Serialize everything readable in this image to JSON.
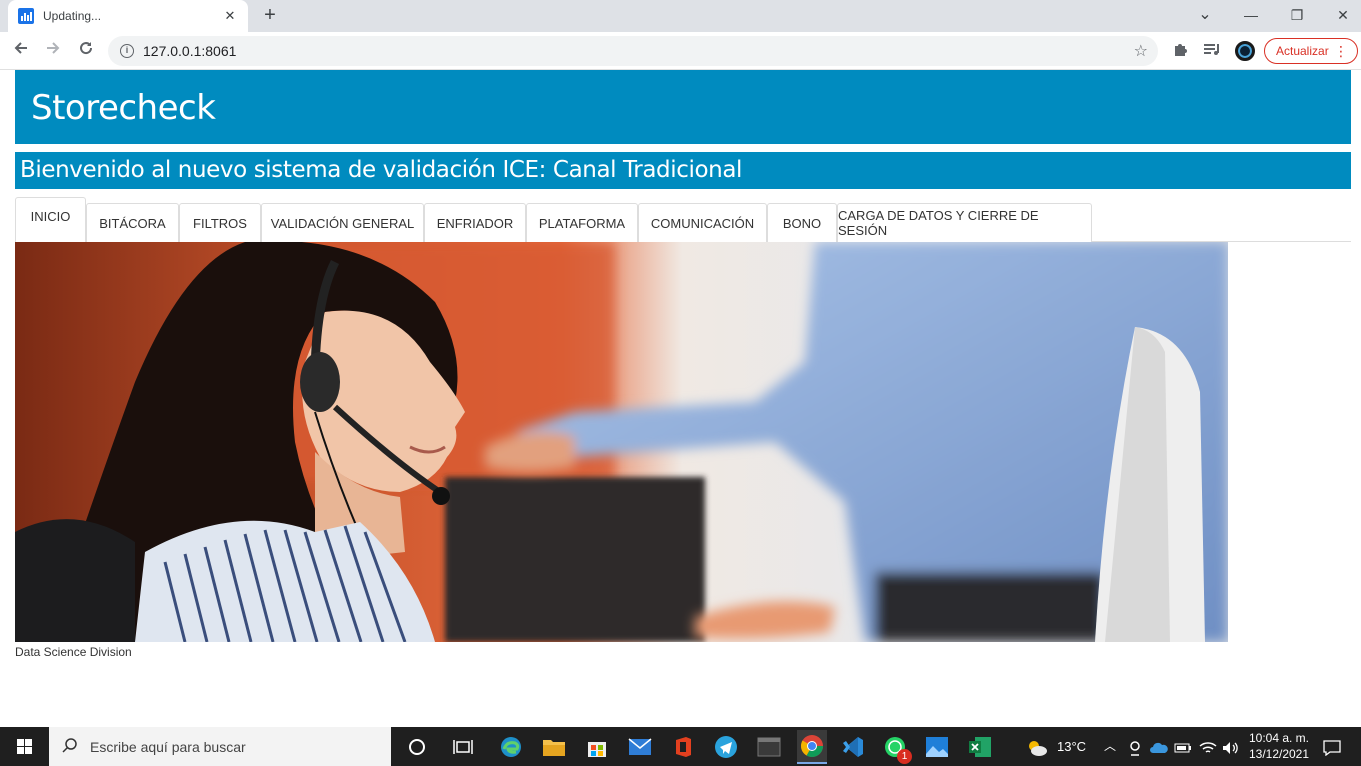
{
  "browser": {
    "tab_title": "Updating...",
    "tab_close": "✕",
    "new_tab": "+",
    "url": "127.0.0.1:8061",
    "update_button": "Actualizar",
    "window_controls": {
      "minimize": "—",
      "restore": "❐",
      "close": "✕",
      "tabsearch": "⌄"
    }
  },
  "app": {
    "title": "Storecheck",
    "subtitle": "Bienvenido al nuevo sistema de validación ICE: Canal Tradicional",
    "tabs": [
      {
        "label": "INICIO",
        "active": true
      },
      {
        "label": "BITÁCORA",
        "active": false
      },
      {
        "label": "FILTROS",
        "active": false
      },
      {
        "label": "VALIDACIÓN GENERAL",
        "active": false
      },
      {
        "label": "ENFRIADOR",
        "active": false
      },
      {
        "label": "PLATAFORMA",
        "active": false
      },
      {
        "label": "COMUNICACIÓN",
        "active": false
      },
      {
        "label": "BONO",
        "active": false
      },
      {
        "label": "CARGA DE DATOS Y CIERRE DE SESIÓN",
        "active": false
      }
    ],
    "footer": "Data Science Division"
  },
  "taskbar": {
    "search_placeholder": "Escribe aquí para buscar",
    "weather": "13°C",
    "time": "10:04 a. m.",
    "date": "13/12/2021",
    "whatsapp_badge": "1"
  },
  "colors": {
    "header_blue": "#008bbf",
    "tab_text": "#333333",
    "update_red": "#d93025"
  }
}
